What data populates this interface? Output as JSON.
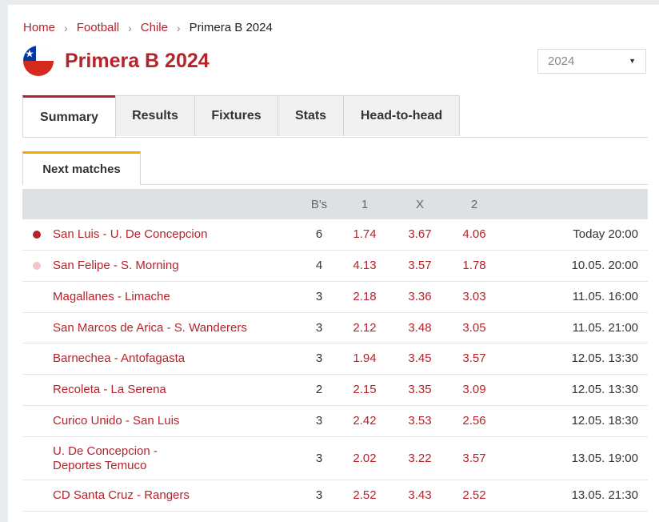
{
  "breadcrumb": {
    "home": "Home",
    "sport": "Football",
    "country": "Chile",
    "current": "Primera B 2024",
    "separator": "›"
  },
  "title": "Primera B 2024",
  "season_select": {
    "value": "2024"
  },
  "tabs": [
    {
      "label": "Summary",
      "active": true
    },
    {
      "label": "Results",
      "active": false
    },
    {
      "label": "Fixtures",
      "active": false
    },
    {
      "label": "Stats",
      "active": false
    },
    {
      "label": "Head-to-head",
      "active": false
    }
  ],
  "subtab": {
    "label": "Next matches"
  },
  "table": {
    "headers": {
      "bs": "B's",
      "one": "1",
      "x": "X",
      "two": "2"
    },
    "rows": [
      {
        "teams": "San Luis - U. De Concepcion",
        "bs": "6",
        "o1": "1.74",
        "ox": "3.67",
        "o2": "4.06",
        "time": "Today 20:00",
        "marker": "live"
      },
      {
        "teams": "San Felipe - S. Morning",
        "bs": "4",
        "o1": "4.13",
        "ox": "3.57",
        "o2": "1.78",
        "time": "10.05. 20:00",
        "marker": "soon"
      },
      {
        "teams": "Magallanes - Limache",
        "bs": "3",
        "o1": "2.18",
        "ox": "3.36",
        "o2": "3.03",
        "time": "11.05. 16:00",
        "marker": "none"
      },
      {
        "teams": "San Marcos de Arica - S. Wanderers",
        "bs": "3",
        "o1": "2.12",
        "ox": "3.48",
        "o2": "3.05",
        "time": "11.05. 21:00",
        "marker": "none"
      },
      {
        "teams": "Barnechea - Antofagasta",
        "bs": "3",
        "o1": "1.94",
        "ox": "3.45",
        "o2": "3.57",
        "time": "12.05. 13:30",
        "marker": "none"
      },
      {
        "teams": "Recoleta - La Serena",
        "bs": "2",
        "o1": "2.15",
        "ox": "3.35",
        "o2": "3.09",
        "time": "12.05. 13:30",
        "marker": "none"
      },
      {
        "teams": "Curico Unido - San Luis",
        "bs": "3",
        "o1": "2.42",
        "ox": "3.53",
        "o2": "2.56",
        "time": "12.05. 18:30",
        "marker": "none"
      },
      {
        "teams": "U. De Concepcion -\nDeportes Temuco",
        "bs": "3",
        "o1": "2.02",
        "ox": "3.22",
        "o2": "3.57",
        "time": "13.05. 19:00",
        "marker": "none"
      },
      {
        "teams": "CD Santa Cruz - Rangers",
        "bs": "3",
        "o1": "2.52",
        "ox": "3.43",
        "o2": "2.52",
        "time": "13.05. 21:30",
        "marker": "none"
      }
    ]
  },
  "colors": {
    "accent": "#b5232b",
    "subtab_accent": "#f2a900",
    "live_dot": "#b5232b",
    "soon_dot": "#f2c6c8"
  },
  "icons": {
    "flag": "chile-flag-icon",
    "dropdown": "caret-down-icon"
  }
}
